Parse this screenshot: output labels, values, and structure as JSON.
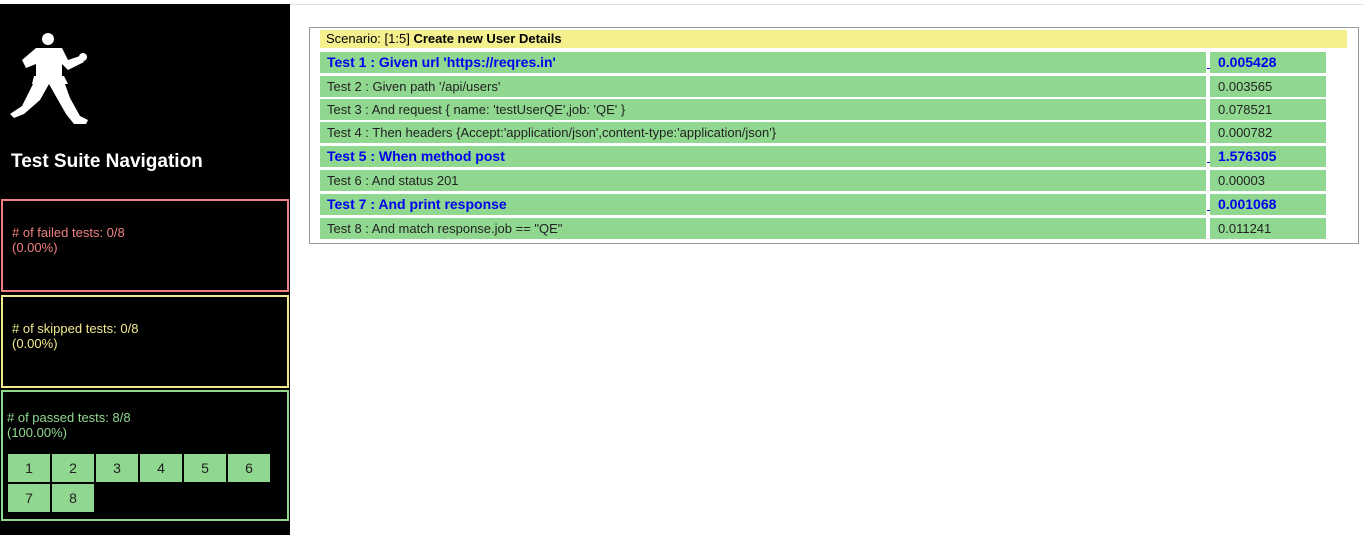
{
  "sidebar": {
    "logo_icon": "karate-figure-icon",
    "title": "Test Suite Navigation",
    "failed": {
      "label": "# of failed tests: 0/8",
      "percent": "(0.00%)",
      "color": "#f08080"
    },
    "skipped": {
      "label": "# of skipped tests: 0/8",
      "percent": "(0.00%)",
      "color": "#f0ea8e"
    },
    "passed": {
      "label": "# of passed tests: 8/8",
      "percent": "(100.00%)",
      "color": "#90d890"
    },
    "pages": [
      "1",
      "2",
      "3",
      "4",
      "5",
      "6",
      "7",
      "8"
    ]
  },
  "scenario": {
    "prefix": "Scenario: [1:5] ",
    "name": "Create new User Details",
    "color": "#f5f08e"
  },
  "tests": [
    {
      "label": "Test 1 : Given url 'https://reqres.in'",
      "duration": "0.005428",
      "highlighted": true
    },
    {
      "label": "Test 2 : Given path '/api/users'",
      "duration": "0.003565",
      "highlighted": false
    },
    {
      "label": "Test 3 : And request { name: 'testUserQE',job: 'QE' }",
      "duration": "0.078521",
      "highlighted": false
    },
    {
      "label": "Test 4 : Then headers {Accept:'application/json',content-type:'application/json'}",
      "duration": "0.000782",
      "highlighted": false
    },
    {
      "label": "Test 5 : When method post",
      "duration": "1.576305",
      "highlighted": true
    },
    {
      "label": "Test 6 : And status 201",
      "duration": "0.00003",
      "highlighted": false
    },
    {
      "label": "Test 7 : And print response",
      "duration": "0.001068",
      "highlighted": true
    },
    {
      "label": "Test 8 : And match response.job == \"QE\"",
      "duration": "0.011241",
      "highlighted": false
    }
  ],
  "colors": {
    "pass_green": "#90d890",
    "link_blue": "#0000ee"
  }
}
